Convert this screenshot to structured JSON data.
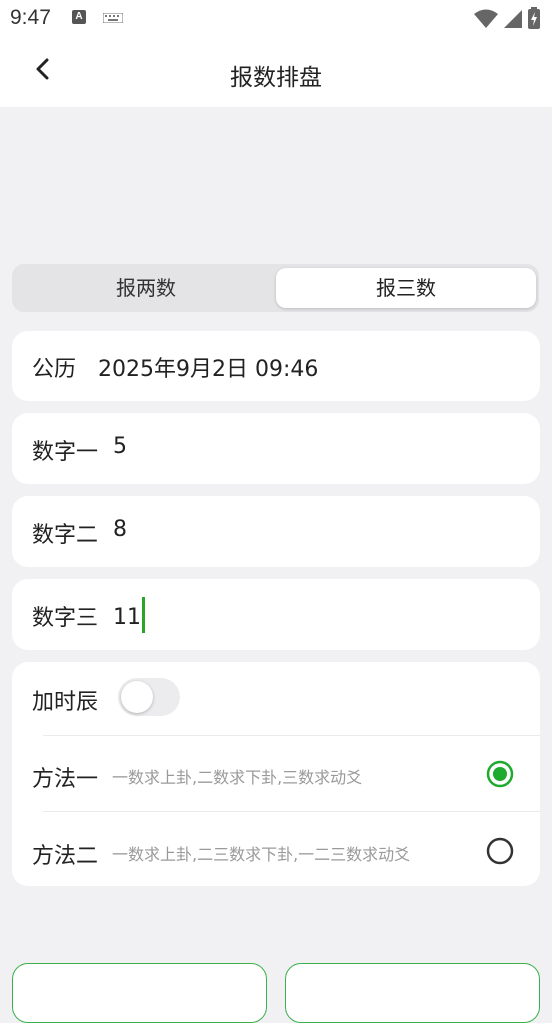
{
  "status_bar": {
    "time": "9:47",
    "notif_icon_letter": "A"
  },
  "header": {
    "title": "报数排盘"
  },
  "tabs": [
    {
      "label": "报两数",
      "selected": false
    },
    {
      "label": "报三数",
      "selected": true
    }
  ],
  "form": {
    "calendar_label": "公历",
    "calendar_value": "2025年9月2日 09:46",
    "num1_label": "数字一",
    "num1_value": "5",
    "num2_label": "数字二",
    "num2_value": "8",
    "num3_label": "数字三",
    "num3_value": "11"
  },
  "options": {
    "add_hour_label": "加时辰",
    "add_hour_on": false,
    "method1_label": "方法一",
    "method1_desc": "一数求上卦,二数求下卦,三数求动爻",
    "method1_selected": true,
    "method2_label": "方法二",
    "method2_desc": "一数求上卦,二三数求下卦,一二三数求动爻",
    "method2_selected": false
  },
  "colors": {
    "accent": "#1eaa2c",
    "background": "#f1f1f3"
  }
}
